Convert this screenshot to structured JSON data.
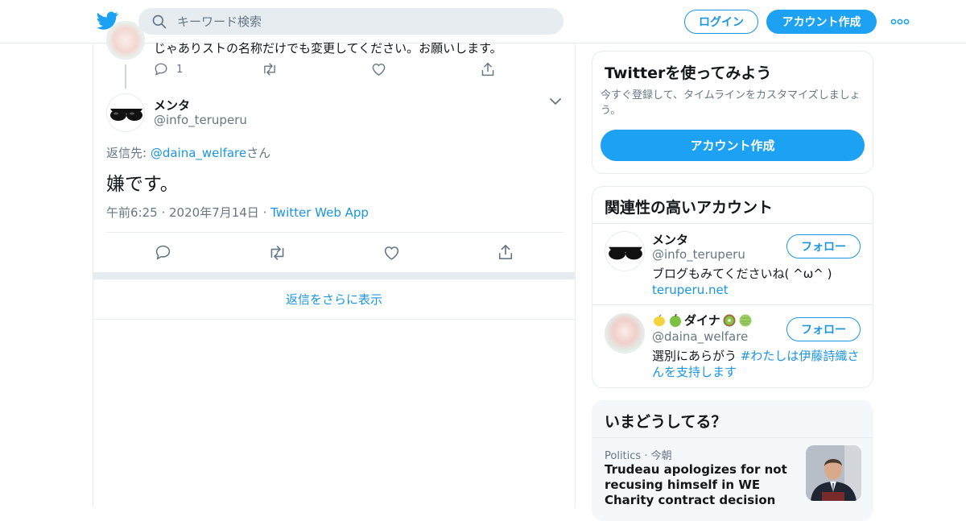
{
  "header": {
    "search_placeholder": "キーワード検索",
    "login_label": "ログイン",
    "signup_label": "アカウント作成"
  },
  "prev_tweet": {
    "text": "じゃありストの名称だけでも変更してください。お願いします。",
    "reply_count": "1"
  },
  "tweet": {
    "name": "メンタ",
    "handle": "@info_teruperu",
    "reply_prefix": "返信先: ",
    "reply_handle": "@daina_welfare",
    "reply_suffix": "さん",
    "text": "嫌です。",
    "time": "午前6:25",
    "date": "2020年7月14日",
    "source": "Twitter Web App"
  },
  "more_replies_label": "返信をさらに表示",
  "sidebar": {
    "try": {
      "title": "Twitterを使ってみよう",
      "description": "今すぐ登録して、タイムラインをカスタマイズしましょう。",
      "button": "アカウント作成"
    },
    "related": {
      "title": "関連性の高いアカウント",
      "accounts": [
        {
          "name": "メンタ",
          "handle": "@info_teruperu",
          "bio": "ブログもみてくださいね( ^ω^ )",
          "link": "teruperu.net",
          "follow_label": "フォロー"
        },
        {
          "name": "ダイナ",
          "handle": "@daina_welfare",
          "bio": "選別にあらがう ",
          "bio_hashtag": "#わたしは伊藤詩織さんを支持します",
          "follow_label": "フォロー"
        }
      ]
    },
    "trends": {
      "title": "いまどうしてる？",
      "items": [
        {
          "category": "Politics",
          "time": "今朝",
          "headline": "Trudeau apologizes for not recusing himself in WE Charity contract decision"
        }
      ]
    }
  },
  "colors": {
    "accent": "#1da1f2",
    "link": "#1b95e0",
    "muted": "#657786",
    "border": "#e6ecf0"
  }
}
